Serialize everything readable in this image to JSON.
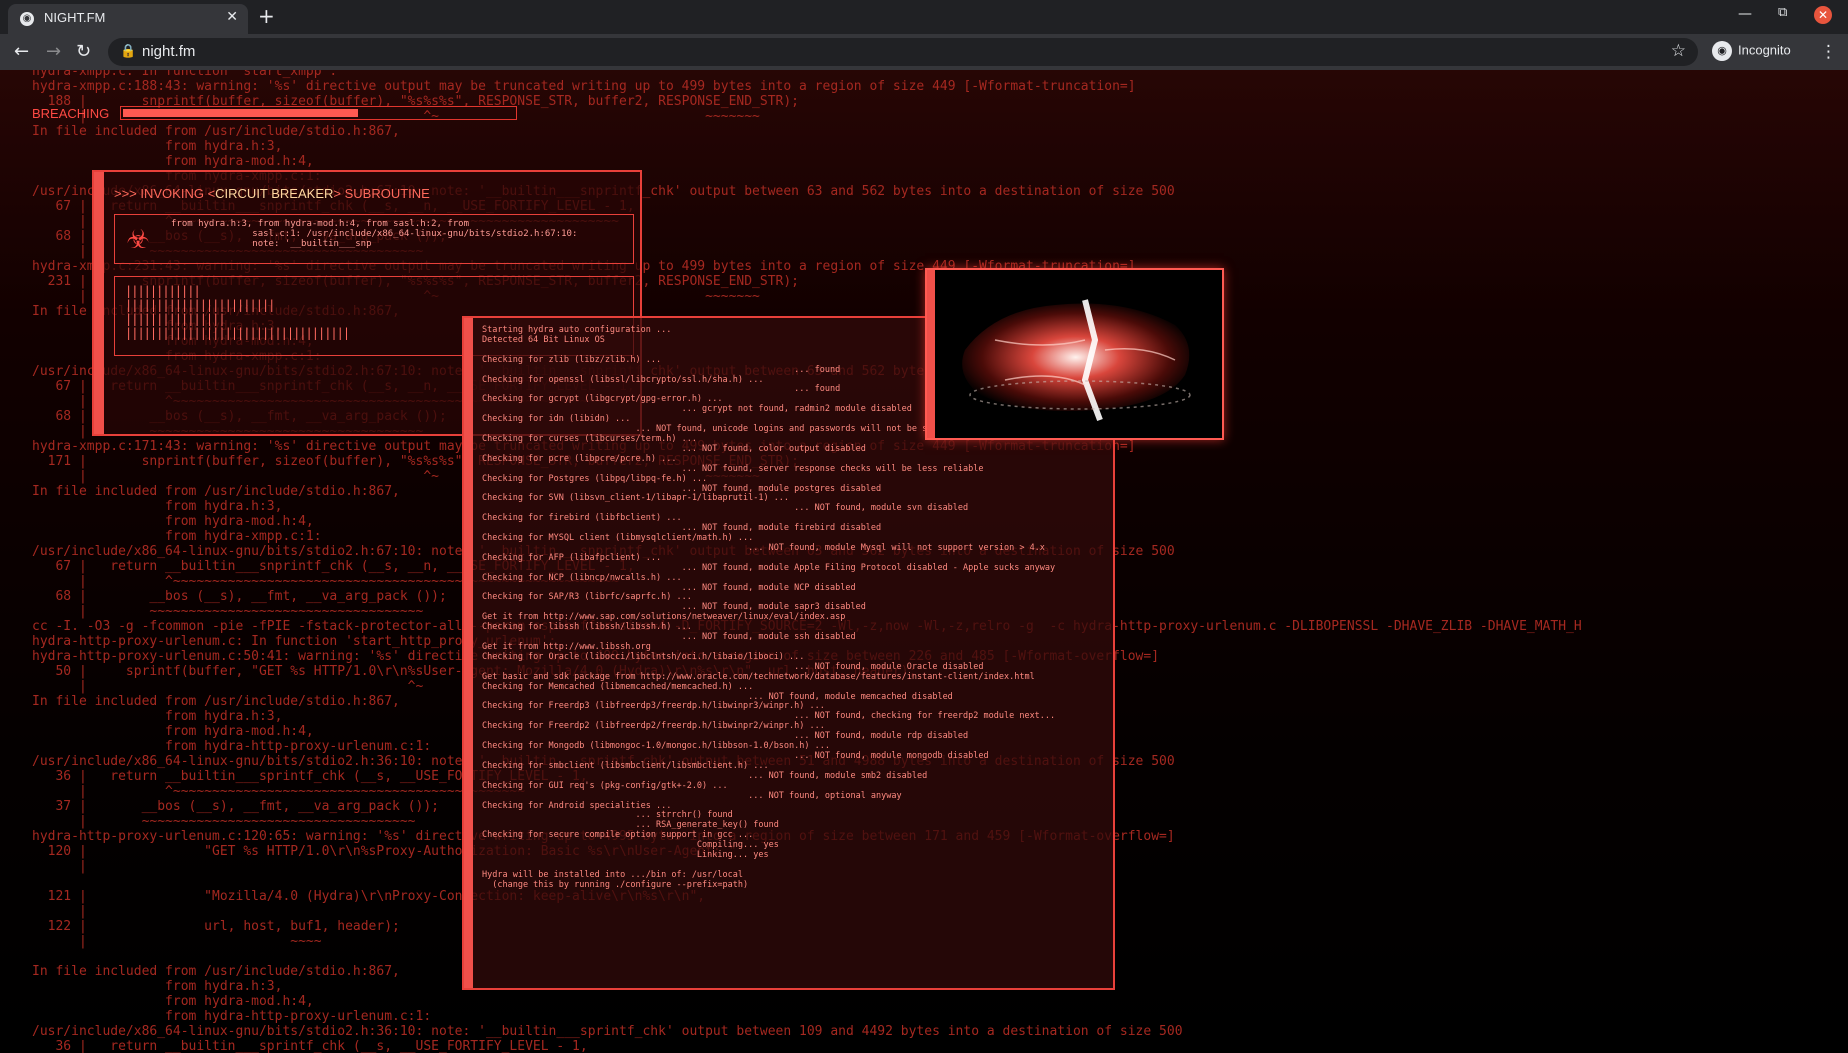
{
  "browser": {
    "tab_title": "NIGHT.FM",
    "url": "night.fm",
    "incognito_label": "Incognito",
    "icons": [
      "globe-icon",
      "close-icon",
      "plus-icon",
      "back-icon",
      "forward-icon",
      "reload-icon",
      "lock-icon",
      "star-icon",
      "incognito-icon",
      "menu-icon",
      "minimize-icon",
      "maximize-icon",
      "close-window-icon"
    ]
  },
  "overlay": {
    "breaching_label": "BREACHING",
    "breaching_progress": 0.6,
    "cb_title_prefix": ">>> INVOKING <",
    "cb_title_highlight": "CIRCUIT BREAKER",
    "cb_title_suffix": "> SUBROUTINE",
    "cb_info_lines": [
      "from hydra.h:3, from hydra-mod.h:4, from sasl.h:2, from",
      "               sasl.c:1: /usr/include/x86_64-linux-gnu/bits/stdio2.h:67:10:",
      "               note: '__builtin___snp"
    ],
    "cb_bars": [
      "||||||||||||",
      "||||||||||||||||||||||||",
      "||||||||||||||||",
      "||||||||||||||||||||||||||||||||||||"
    ],
    "hydra_lines": [
      "Starting hydra auto configuration ...",
      "Detected 64 Bit Linux OS",
      "",
      "Checking for zlib (libz/zlib.h) ...",
      "                                                             ... found",
      "Checking for openssl (libssl/libcrypto/ssl.h/sha.h) ...",
      "                                                             ... found",
      "Checking for gcrypt (libgcrypt/gpg-error.h) ...",
      "                                       ... gcrypt not found, radmin2 module disabled",
      "Checking for idn (libidn) ...",
      "                              ... NOT found, unicode logins and passwords will not be supported",
      "Checking for curses (libcurses/term.h) ...",
      "                                       ... NOT found, color output disabled",
      "Checking for pcre (libpcre/pcre.h) ...",
      "                                       ... NOT found, server response checks will be less reliable",
      "Checking for Postgres (libpq/libpq-fe.h) ...",
      "                                       ... NOT found, module postgres disabled",
      "Checking for SVN (libsvn_client-1/libapr-1/libaprutil-1) ...",
      "                                                             ... NOT found, module svn disabled",
      "Checking for firebird (libfbclient) ...",
      "                                       ... NOT found, module firebird disabled",
      "Checking for MYSQL client (libmysqlclient/math.h) ...",
      "                                                    ... NOT found, module Mysql will not support version > 4.x",
      "Checking for AFP (libafpclient) ...",
      "                                       ... NOT found, module Apple Filing Protocol disabled - Apple sucks anyway",
      "Checking for NCP (libncp/nwcalls.h) ...",
      "                                       ... NOT found, module NCP disabled",
      "Checking for SAP/R3 (librfc/saprfc.h) ...",
      "                                       ... NOT found, module sapr3 disabled",
      "Get it from http://www.sap.com/solutions/netweaver/linux/eval/index.asp",
      "Checking for libssh (libssh/libssh.h) ...",
      "                                       ... NOT found, module ssh disabled",
      "Get it from http://www.libssh.org",
      "Checking for Oracle (libocci/libclntsh/oci.h/libaio/liboci) ...",
      "                                                             ... NOT found, module Oracle disabled",
      "Get basic and sdk package from http://www.oracle.com/technetwork/database/features/instant-client/index.html",
      "Checking for Memcached (libmemcached/memcached.h) ...",
      "                                                    ... NOT found, module memcached disabled",
      "Checking for Freerdp3 (libfreerdp3/freerdp.h/libwinpr3/winpr.h) ...",
      "                                                             ... NOT found, checking for freerdp2 module next...",
      "Checking for Freerdp2 (libfreerdp2/freerdp.h/libwinpr2/winpr.h) ...",
      "                                                             ... NOT found, module rdp disabled",
      "Checking for Mongodb (libmongoc-1.0/mongoc.h/libbson-1.0/bson.h) ...",
      "                                                             ... NOT found, module mongodb disabled",
      "Checking for smbclient (libsmbclient/libsmbclient.h) ...",
      "                                                    ... NOT found, module smb2 disabled",
      "Checking for GUI req's (pkg-config/gtk+-2.0) ...",
      "                                                    ... NOT found, optional anyway",
      "Checking for Android specialities ...",
      "                              ... strrchr() found",
      "                              ... RSA_generate_key() found",
      "Checking for secure compile option support in gcc ...",
      "                                          Compiling... yes",
      "                                          Linking... yes",
      "",
      "Hydra will be installed into .../bin of: /usr/local",
      "  (change this by running ./configure --prefix=path)"
    ],
    "image_desc": "glowing-cracked-rock"
  },
  "background_log": [
    "hydra-xmpp.c: In function 'start_xmpp':",
    "hydra-xmpp.c:188:43: warning: '%s' directive output may be truncated writing up to 499 bytes into a region of size 449 [-Wformat-truncation=]",
    "  188 |       snprintf(buffer, sizeof(buffer), \"%s%s%s\", RESPONSE_STR, buffer2, RESPONSE_END_STR);",
    "      |                                           ^~                                  ~~~~~~~",
    "In file included from /usr/include/stdio.h:867,",
    "                 from hydra.h:3,",
    "                 from hydra-mod.h:4,",
    "                 from hydra-xmpp.c:1:",
    "/usr/include/x86_64-linux-gnu/bits/stdio2.h:67:10: note: '__builtin___snprintf_chk' output between 63 and 562 bytes into a destination of size 500",
    "   67 |   return __builtin___snprintf_chk (__s, __n, __USE_FORTIFY_LEVEL - 1,",
    "      |          ^~~~~~~~~~~~~~~~~~~~~~~~~~~~~~~~~~~~~~~~~~~~~~~~~~~~~~~~~~",
    "   68 |        __bos (__s), __fmt, __va_arg_pack ());",
    "      |        ~~~~~~~~~~~~~~~~~~~~~~~~~~~~~~~~~~~",
    "hydra-xmpp.c:231:43: warning: '%s' directive output may be truncated writing up to 499 bytes into a region of size 449 [-Wformat-truncation=]",
    "  231 |       snprintf(buffer, sizeof(buffer), \"%s%s%s\", RESPONSE_STR, buffer2, RESPONSE_END_STR);",
    "      |                                           ^~                                  ~~~~~~~",
    "In file included from /usr/include/stdio.h:867,",
    "                 from hydra.h:3,",
    "                 from hydra-mod.h:4,",
    "                 from hydra-xmpp.c:1:",
    "/usr/include/x86_64-linux-gnu/bits/stdio2.h:67:10: note: '__builtin___snprintf_chk' output between 63 and 562 bytes into a destination of size 500",
    "   67 |   return __builtin___snprintf_chk (__s, __n, __USE_FORTIFY_LEVEL - 1,",
    "      |          ^~~~~~~~~~~~~~~~~~~~~~~~~~~~~~~~~~~~~~~~~~~~~~~~~~~~~~~~~~",
    "   68 |        __bos (__s), __fmt, __va_arg_pack ());",
    "      |        ~~~~~~~~~~~~~~~~~~~~~~~~~~~~~~~~~~~",
    "hydra-xmpp.c:171:43: warning: '%s' directive output may be truncated writing up to 499 bytes into a region of size 449 [-Wformat-truncation=]",
    "  171 |       snprintf(buffer, sizeof(buffer), \"%s%s%s\", RESPONSE_STR, buffer2, RESPONSE_END_STR);",
    "      |                                           ^~                                  ~~~~~~~",
    "In file included from /usr/include/stdio.h:867,",
    "                 from hydra.h:3,",
    "                 from hydra-mod.h:4,",
    "                 from hydra-xmpp.c:1:",
    "/usr/include/x86_64-linux-gnu/bits/stdio2.h:67:10: note: '__builtin___snprintf_chk' output between 63 and 562 bytes into a destination of size 500",
    "   67 |   return __builtin___snprintf_chk (__s, __n, __USE_FORTIFY_LEVEL - 1,",
    "      |          ^~~~~~~~~~~~~~~~~~~~~~~~~~~~~~~~~~~~~~~~~~~~~~~~~~~~~~~~~~",
    "   68 |        __bos (__s), __fmt, __va_arg_pack ());",
    "      |        ~~~~~~~~~~~~~~~~~~~~~~~~~~~~~~~~~~~",
    "cc -I. -O3 -g -fcommon -pie -fPIE -fstack-protector-all --param ssp-buffer-size=4 -D_FORTIFY_SOURCE=2 -Wl,-z,now -Wl,-z,relro -g  -c hydra-http-proxy-urlenum.c -DLIBOPENSSL -DHAVE_ZLIB -DHAVE_MATH_H",
    "hydra-http-proxy-urlenum.c: In function 'start_http_proxy_urlenum':",
    "hydra-http-proxy-urlenum.c:50:41: warning: '%s' directive writing up to 499 bytes into a region of size between 226 and 485 [-Wformat-overflow=]",
    "   50 |     sprintf(buffer, \"GET %s HTTP/1.0\\r\\n%sUser-Agent: Mozilla/4.0 (Hydra)\\r\\n%s\\r\\n\", url, host, header);",
    "      |                                         ^~",
    "In file included from /usr/include/stdio.h:867,",
    "                 from hydra.h:3,",
    "                 from hydra-mod.h:4,",
    "                 from hydra-http-proxy-urlenum.c:1:",
    "/usr/include/x86_64-linux-gnu/bits/stdio2.h:36:10: note: '__builtin___sprintf_chk' output between 51 and 4988 bytes into a destination of size 500",
    "   36 |   return __builtin___sprintf_chk (__s, __USE_FORTIFY_LEVEL - 1,",
    "      |          ^~~~~~~~~~~~~~~~~~~~~~~~~~~~~~~~~~~~~~~~~~~~~~",
    "   37 |       __bos (__s), __fmt, __va_arg_pack ());",
    "      |       ~~~~~~~~~~~~~~~~~~~~~~~~~~~~~~~~~~~",
    "hydra-http-proxy-urlenum.c:120:65: warning: '%s' directive writing up to 4995 bytes into a region of size between 171 and 459 [-Wformat-overflow=]",
    "  120 |               \"GET %s HTTP/1.0\\r\\n%sProxy-Authorization: Basic %s\\r\\nUser-Agent: \"",
    "      |",
    "",
    "  121 |               \"Mozilla/4.0 (Hydra)\\r\\nProxy-Connection: keep-alive\\r\\n%s\\r\\n\",",
    "      |",
    "  122 |               url, host, buf1, header);",
    "      |                          ~~~~",
    "",
    "In file included from /usr/include/stdio.h:867,",
    "                 from hydra.h:3,",
    "                 from hydra-mod.h:4,",
    "                 from hydra-http-proxy-urlenum.c:1:",
    "/usr/include/x86_64-linux-gnu/bits/stdio2.h:36:10: note: '__builtin___sprintf_chk' output between 109 and 4492 bytes into a destination of size 500",
    "   36 |   return __builtin___sprintf_chk (__s, __USE_FORTIFY_LEVEL - 1,"
  ]
}
